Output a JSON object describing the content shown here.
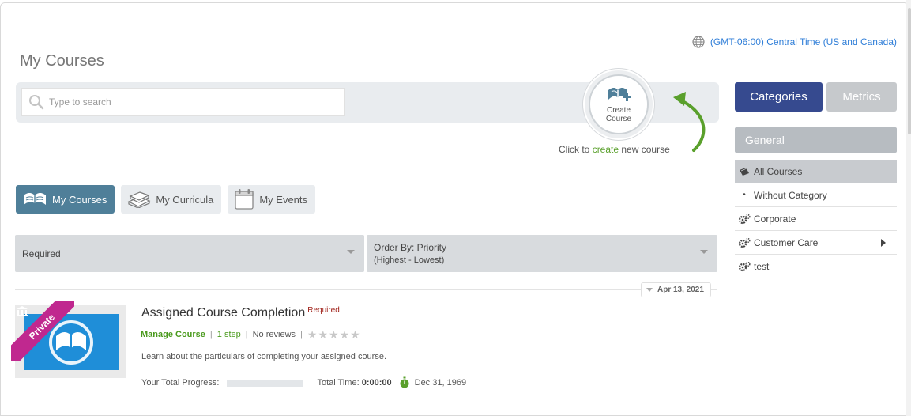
{
  "page_title": "My Courses",
  "timezone": "(GMT-06:00) Central Time (US and Canada)",
  "search": {
    "placeholder": "Type to search"
  },
  "create": {
    "label": "Create Course",
    "hint_prefix": "Click to ",
    "hint_link": "create",
    "hint_suffix": " new course"
  },
  "tabs": [
    {
      "label": "My Courses",
      "active": true
    },
    {
      "label": "My Curricula",
      "active": false
    },
    {
      "label": "My Events",
      "active": false
    }
  ],
  "filters": {
    "status": "Required",
    "order_by": "Order By: Priority",
    "order_by_sub": "(Highest - Lowest)"
  },
  "date_group": "Apr 13, 2021",
  "course": {
    "badge": "Private",
    "title": "Assigned Course Completion",
    "required": "Required",
    "manage": "Manage Course",
    "steps": "1 step",
    "reviews": "No reviews",
    "rating": 0,
    "rating_max": 5,
    "description": "Learn about the particulars of completing your assigned course.",
    "progress_label": "Your Total Progress:",
    "progress": 0,
    "time_label": "Total Time:",
    "time_value": "0:00:00",
    "due_date": "Dec 31, 1969"
  },
  "sidebar": {
    "categories_btn": "Categories",
    "metrics_btn": "Metrics",
    "header": "General",
    "items": [
      {
        "label": "All Courses",
        "selected": true,
        "icon": "tag-icon"
      },
      {
        "label": "Without Category",
        "selected": false,
        "icon": "bullet"
      },
      {
        "label": "Corporate",
        "selected": false,
        "icon": "gears-icon"
      },
      {
        "label": "Customer Care",
        "selected": false,
        "icon": "gears-icon",
        "has_children": true
      },
      {
        "label": "test",
        "selected": false,
        "icon": "gears-icon"
      }
    ]
  },
  "colors": {
    "primary": "#364a8f",
    "tab_active": "#4f7f99",
    "link_green": "#4a9a1d",
    "link_blue": "#2f7ed8",
    "required_red": "#a0221a",
    "private_badge": "#c0288f",
    "thumb_blue": "#1f8ed8"
  }
}
